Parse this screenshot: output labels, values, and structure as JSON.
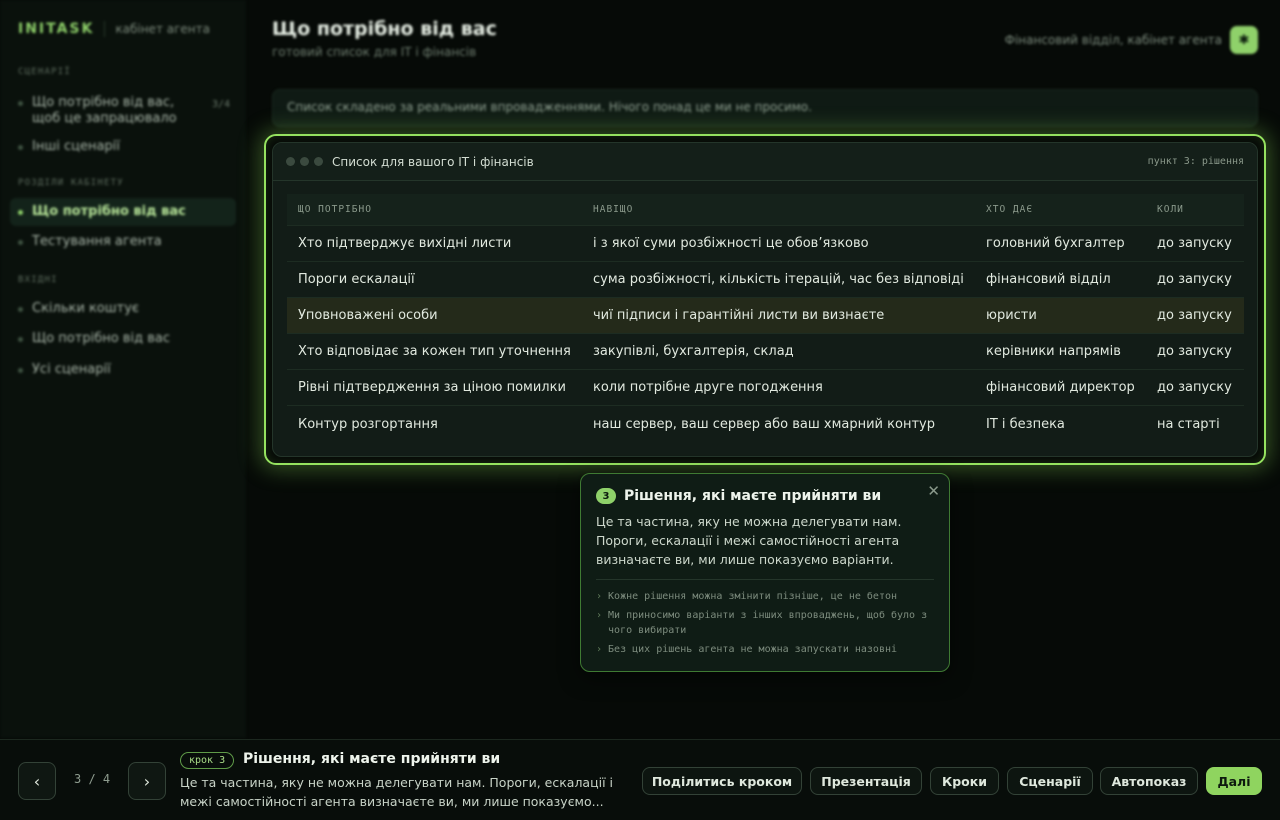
{
  "sidebar": {
    "brand": "INITASK",
    "brand_sub": "кабінет агента",
    "sections": [
      {
        "title": "СЦЕНАРІЇ",
        "items": [
          {
            "label": "Що потрібно від вас, щоб це запрацювало",
            "count": "3/4"
          },
          {
            "label": "Інші сценарії"
          }
        ]
      },
      {
        "title": "РОЗДІЛИ КАБІНЕТУ",
        "items": [
          {
            "label": "Що потрібно від вас"
          },
          {
            "label": "Тестування агента"
          }
        ]
      },
      {
        "title": "ВХІДНІ",
        "items": [
          {
            "label": "Скільки коштує"
          },
          {
            "label": "Що потрібно від вас"
          },
          {
            "label": "Усі сценарії"
          }
        ]
      }
    ]
  },
  "header": {
    "title": "Що потрібно від вас",
    "subtitle": "готовий список для IT і фінансів",
    "context": "Фінансовий відділ, кабінет агента",
    "avatar_icon": "✱"
  },
  "notice": "Список складено за реальними впровадженнями. Нічого понад це ми не просимо.",
  "card": {
    "title": "Список для вашого IT і фінансів",
    "step": "пункт 3: рішення",
    "columns": [
      "ЩО ПОТРІБНО",
      "НАВІЩО",
      "ХТО ДАЄ",
      "КОЛИ"
    ],
    "rows": [
      [
        "Хто підтверджує вихідні листи",
        "і з якої суми розбіжності це обов’язково",
        "головний бухгалтер",
        "до запуску"
      ],
      [
        "Пороги ескалації",
        "сума розбіжності, кількість ітерацій, час без відповіді",
        "фінансовий відділ",
        "до запуску"
      ],
      [
        "Уповноважені особи",
        "чиї підписи і гарантійні листи ви визнаєте",
        "юристи",
        "до запуску"
      ],
      [
        "Хто відповідає за кожен тип уточнення",
        "закупівлі, бухгалтерія, склад",
        "керівники напрямів",
        "до запуску"
      ],
      [
        "Рівні підтвердження за ціною помилки",
        "коли потрібне друге погодження",
        "фінансовий директор",
        "до запуску"
      ],
      [
        "Контур розгортання",
        "наш сервер, ваш сервер або ваш хмарний контур",
        "IT і безпека",
        "на старті"
      ]
    ]
  },
  "tooltip": {
    "number": "3",
    "title": "Рішення, які маєте прийняти ви",
    "body": "Це та частина, яку не можна делегувати нам. Пороги, ескалації і межі самостійності агента визначаєте ви, ми лише показуємо варіанти.",
    "bullets": [
      "Кожне рішення можна змінити пізніше, це не бетон",
      "Ми приносимо варіанти з інших впроваджень, щоб було з чого вибирати",
      "Без цих рішень агента не можна запускати назовні"
    ],
    "close_icon": "✕"
  },
  "footer": {
    "prev_icon": "‹",
    "next_icon": "›",
    "pager": "3 / 4",
    "badge": "крок 3",
    "title": "Рішення, які маєте прийняти ви",
    "desc": "Це та частина, яку не можна делегувати нам. Пороги, ескалації і межі самостійності агента визначаєте ви, ми лише показуємо...",
    "buttons": {
      "share": "Поділитись кроком",
      "presentation": "Презентація",
      "steps": "Кроки",
      "scenarios": "Сценарії",
      "autoplay": "Автопоказ",
      "next": "Далі"
    }
  },
  "colors": {
    "accent": "#8fd16a",
    "background": "#060a07",
    "highlight_border": "#95e25f"
  }
}
